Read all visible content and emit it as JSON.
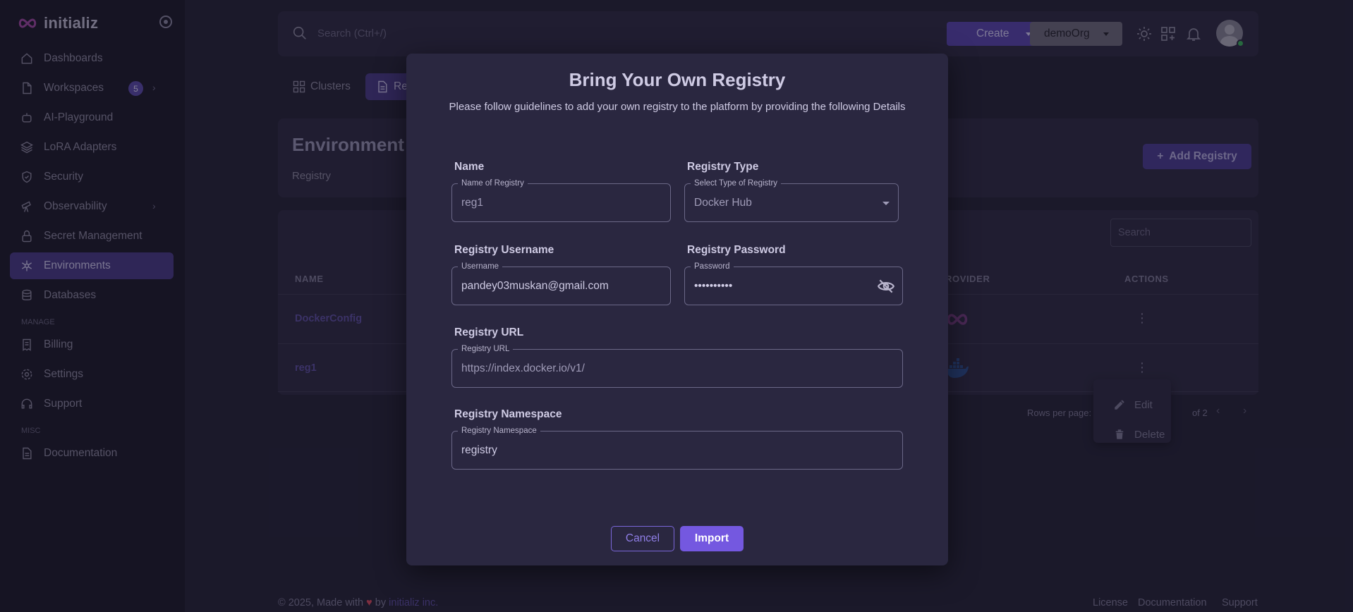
{
  "brand": {
    "name": "initializ"
  },
  "sidebar": {
    "items": [
      {
        "label": "Dashboards"
      },
      {
        "label": "Workspaces",
        "badge": "5"
      },
      {
        "label": "AI-Playground"
      },
      {
        "label": "LoRA Adapters"
      },
      {
        "label": "Security"
      },
      {
        "label": "Observability"
      },
      {
        "label": "Secret Management"
      },
      {
        "label": "Environments",
        "active": true
      },
      {
        "label": "Databases"
      }
    ],
    "manage_label": "MANAGE",
    "manage_items": [
      {
        "label": "Billing"
      },
      {
        "label": "Settings"
      },
      {
        "label": "Support"
      }
    ],
    "misc_label": "MISC",
    "misc_items": [
      {
        "label": "Documentation"
      }
    ]
  },
  "topbar": {
    "search_placeholder": "Search (Ctrl+/)",
    "create_label": "Create",
    "org_label": "demoOrg"
  },
  "tabs": [
    {
      "label": "Clusters"
    },
    {
      "label": "Re"
    }
  ],
  "environment": {
    "title": "Environment",
    "breadcrumb": "Registry",
    "add_button": "Add Registry"
  },
  "table": {
    "search_placeholder": "Search",
    "columns": {
      "name": "NAME",
      "provider": "ROVIDER",
      "actions": "ACTIONS"
    },
    "rows": [
      {
        "name": "DockerConfig"
      },
      {
        "name": "reg1"
      }
    ],
    "rows_per_page_label": "Rows per page:",
    "page_count": "of 2"
  },
  "row_menu": {
    "edit": "Edit",
    "delete": "Delete"
  },
  "footer": {
    "copyright": "© 2025, Made with",
    "by": "by",
    "company": "initializ inc.",
    "links": [
      "License",
      "Documentation",
      "Support"
    ]
  },
  "modal": {
    "title": "Bring Your Own Registry",
    "subtitle": "Please follow guidelines to add your own registry to the platform by providing the following Details",
    "name_label": "Name",
    "name_legend": "Name of Registry",
    "name_value": "reg1",
    "type_label": "Registry Type",
    "type_legend": "Select Type of Registry",
    "type_value": "Docker Hub",
    "username_label": "Registry Username",
    "username_legend": "Username",
    "username_value": "pandey03muskan@gmail.com",
    "password_label": "Registry Password",
    "password_legend": "Password",
    "password_value": "••••••••••",
    "url_label": "Registry URL",
    "url_legend": "Registry URL",
    "url_value": "https://index.docker.io/v1/",
    "namespace_label": "Registry Namespace",
    "namespace_legend": "Registry Namespace",
    "namespace_value": "registry",
    "cancel_label": "Cancel",
    "import_label": "Import"
  },
  "colors": {
    "accent": "#7458e0",
    "sidebar_active": "#4a3b8a",
    "background": "#25233a"
  }
}
